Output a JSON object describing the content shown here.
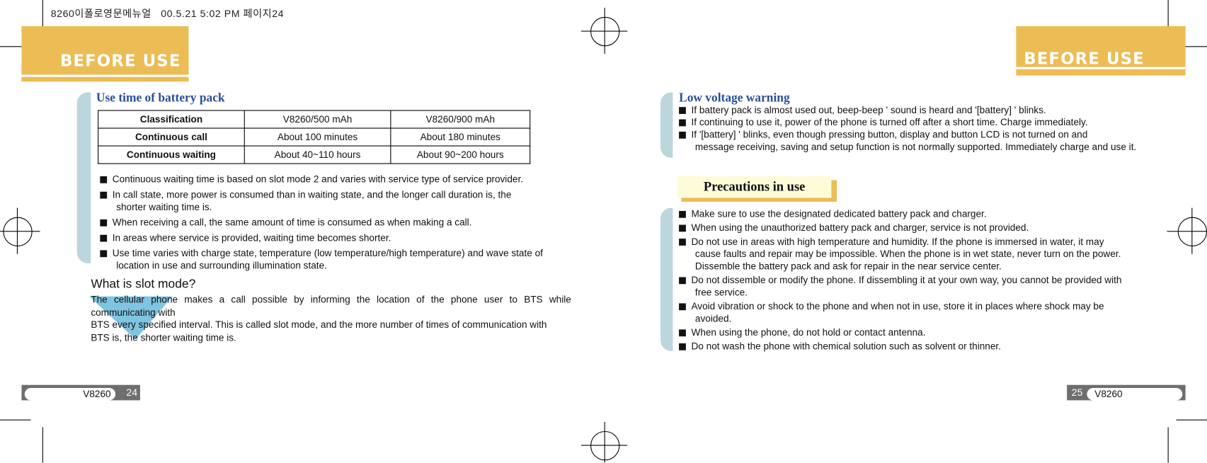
{
  "print_header": "8260이폴로영문메뉴얼   00.5.21 5:02 PM 페이지24",
  "left_page": {
    "banner": "BEFORE USE",
    "heading": "Use time of battery pack",
    "table": {
      "header": [
        "Classification",
        "V8260/500 mAh",
        "V8260/900 mAh"
      ],
      "rows": [
        [
          "Continuous call",
          "About 100 minutes",
          "About 180 minutes"
        ],
        [
          "Continuous waiting",
          "About 40~110 hours",
          "About 90~200 hours"
        ]
      ]
    },
    "bullets": [
      [
        "Continuous waiting  time is based  on slot mode  2 and  varies with service  type of service provider."
      ],
      [
        "In call  state, more  power is  consumed than  in waiting state,  and the  longer call duration is, the",
        "shorter waiting time is."
      ],
      [
        "When receiving a call, the same amount of time is consumed as when making a call."
      ],
      [
        "In areas where service is provided, waiting time becomes shorter."
      ],
      [
        "Use time varies with charge state, temperature (low temperature/high temperature) and wave state of",
        "location in use and surrounding illumination state."
      ]
    ],
    "slot_title": "What is slot mode?",
    "slot_lines": [
      "The cellular phone makes a call possible by informing the location of the phone  user to BTS while",
      "communicating with",
      "BTS every  specified interval. This is called slot  mode, and the more number of times of communication with",
      "BTS is, the  shorter waiting time is."
    ],
    "footer_model": "V8260",
    "footer_page": "24"
  },
  "right_page": {
    "banner": "BEFORE USE",
    "heading": "Low voltage warning",
    "bullets": [
      [
        "If battery pack is almost used out,   beep-beep ' sound is heard and  '[battery] '  blinks."
      ],
      [
        "If continuing to use  it, power of the  phone is turned off after  a short time. Charge immediately."
      ],
      [
        "If  '[battery] '  blinks, even  though pressing button, display and  button LCD is not turned on and",
        "message receiving, saving and setup function is not normally supported. Immediately charge and use it."
      ]
    ],
    "precautions_title": "Precautions in use",
    "precautions": [
      [
        "Make sure to use the designated dedicated battery pack and charger."
      ],
      [
        "When using the unauthorized battery pack and charger, service is not provided."
      ],
      [
        "Do not use in areas with high temperature and humidity. If the phone is immersed in water, it may",
        "cause faults and repair may be impossible. When the phone is in wet state, never turn on the power.",
        "Dissemble the battery pack and ask for repair in the near service center."
      ],
      [
        "Do not dissemble or modify the phone. If dissembling it at your own way, you cannot be provided with",
        "free service."
      ],
      [
        "Avoid vibration or shock to the phone and  when not in use, store it in places  where shock may be",
        "avoided."
      ],
      [
        "When using the phone, do not hold or contact antenna."
      ],
      [
        "Do not wash the phone with chemical solution such as solvent or thinner."
      ]
    ],
    "footer_model": "V8260",
    "footer_page": "25"
  },
  "colors": {
    "banner": "#ECBC55",
    "heading": "#2A4F9A",
    "tab": "#BCD6DD",
    "precautions_bg": "#FEFBD8",
    "footer": "#6E6E6E"
  }
}
